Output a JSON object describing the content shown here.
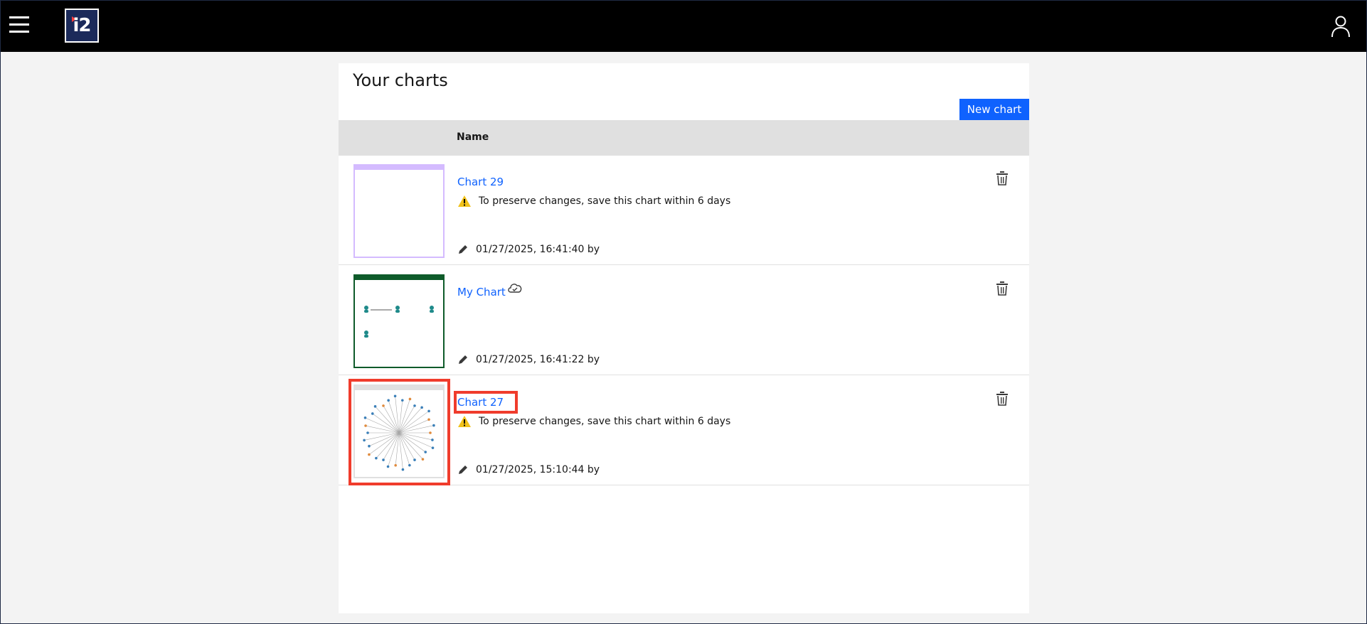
{
  "header": {
    "logo_text": "i2"
  },
  "page": {
    "title": "Your charts",
    "new_chart_label": "New chart"
  },
  "table": {
    "column_name": "Name"
  },
  "charts": [
    {
      "name": "Chart 29",
      "warning": "To preserve changes, save this chart within 6 days",
      "modified": "01/27/2025, 16:41:40 by",
      "thumb_color": "#d4bbff"
    },
    {
      "name": "My Chart",
      "warning": "",
      "modified": "01/27/2025, 16:41:22 by",
      "thumb_color": "#0e5b2a",
      "cloud_icon": "cloud-check-icon"
    },
    {
      "name": "Chart 27",
      "warning": "To preserve changes, save this chart within 6 days",
      "modified": "01/27/2025, 15:10:44 by",
      "thumb_color": "#e0e0e0"
    }
  ],
  "colors": {
    "accent": "#0f62fe",
    "header_bg": "#000000",
    "highlight": "#f03c2c",
    "warning": "#f1c21b"
  }
}
